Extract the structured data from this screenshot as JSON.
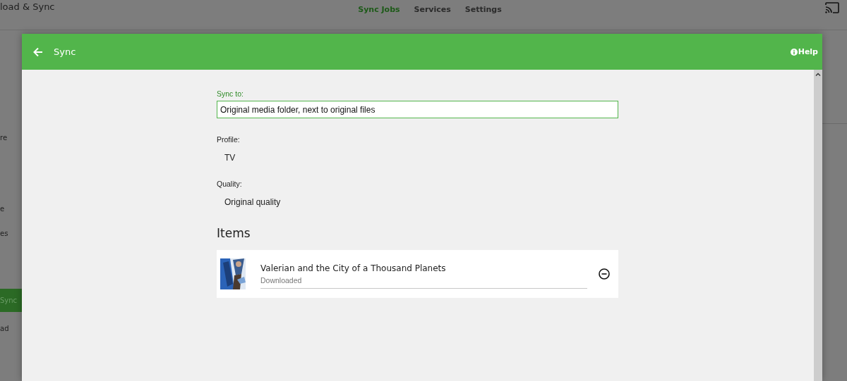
{
  "page": {
    "title": "load & Sync",
    "tabs": [
      {
        "label": "Sync Jobs",
        "selected": true
      },
      {
        "label": "Services",
        "selected": false
      },
      {
        "label": "Settings",
        "selected": false
      }
    ],
    "sidebar": {
      "items": [
        {
          "label": "re",
          "selected": false
        },
        {
          "label": "e",
          "selected": false
        },
        {
          "label": "es",
          "selected": false
        },
        {
          "label": "Sync",
          "selected": true
        },
        {
          "label": "ad",
          "selected": false
        }
      ]
    }
  },
  "dialog": {
    "title": "Sync",
    "help": "Help",
    "sync_to": {
      "label": "Sync to:",
      "value": "Original media folder, next to original files"
    },
    "profile": {
      "label": "Profile:",
      "value": "TV"
    },
    "quality": {
      "label": "Quality:",
      "value": "Original quality"
    },
    "items_heading": "Items",
    "items": [
      {
        "title": "Valerian and the City of a Thousand Planets",
        "status": "Downloaded",
        "kind": "picture"
      }
    ]
  }
}
